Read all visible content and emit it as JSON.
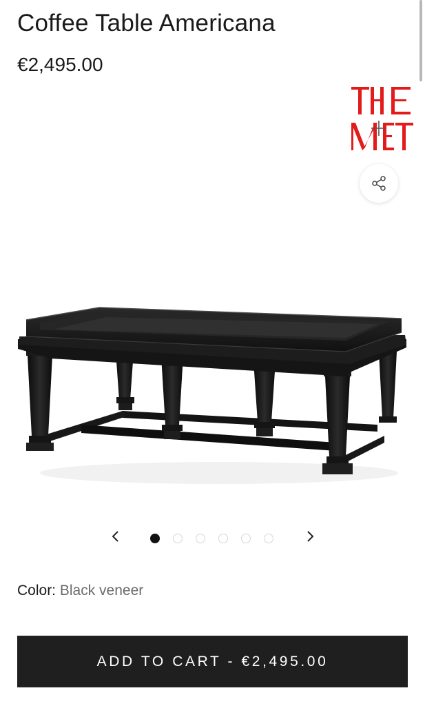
{
  "product": {
    "title": "Coffee Table Americana",
    "price": "€2,495.00"
  },
  "gallery": {
    "logo_text": "THE MET",
    "zoom_icon": "plus-icon",
    "share_icon": "share-icon",
    "image_alt": "Black veneer coffee table with tray top",
    "slide_count": 6,
    "active_slide": 1
  },
  "carousel": {
    "prev_icon": "chevron-left-icon",
    "next_icon": "chevron-right-icon"
  },
  "options": {
    "color_label": "Color:",
    "color_value": "Black veneer"
  },
  "cart": {
    "add_to_cart_label": "ADD TO CART - €2,495.00"
  },
  "colors": {
    "accent_red": "#e31b1b",
    "button_bg": "#1f1f1f",
    "muted_text": "#6b6b6b"
  }
}
